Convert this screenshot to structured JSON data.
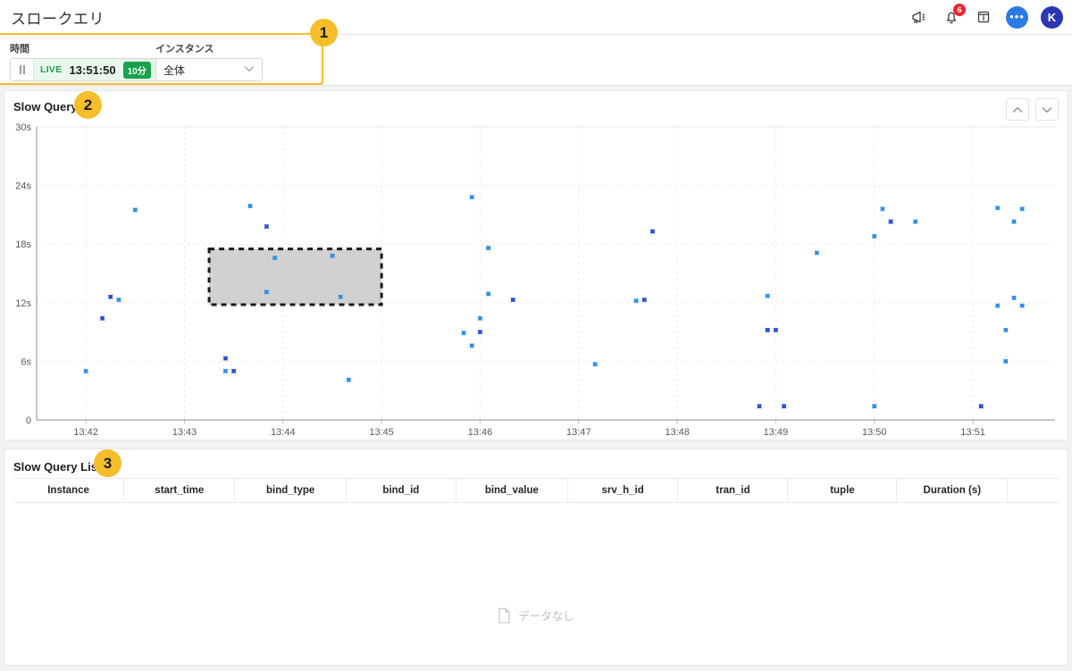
{
  "header": {
    "title": "スロークエリ",
    "icons": [
      {
        "name": "megaphone-icon",
        "label": "announcements"
      },
      {
        "name": "bell-icon",
        "label": "notifications",
        "badge": "6"
      },
      {
        "name": "info-box-icon",
        "label": "info"
      },
      {
        "name": "chat-icon",
        "label": "chat",
        "glyph": "•••"
      },
      {
        "name": "avatar",
        "label": "K"
      }
    ]
  },
  "filters": {
    "time": {
      "label": "時間",
      "pause_aria": "pause",
      "live_label": "LIVE",
      "time_value": "13:51:50",
      "range_badge": "10分"
    },
    "instance": {
      "label": "インスタンス",
      "value": "全体",
      "options": [
        "全体"
      ]
    }
  },
  "badges": {
    "one": "1",
    "two": "2",
    "three": "3"
  },
  "chart_panel": {
    "title": "Slow Query",
    "scroll_up_label": "∧",
    "scroll_down_label": "∨"
  },
  "table_panel": {
    "title": "Slow Query List",
    "columns": [
      "Instance",
      "start_time",
      "bind_type",
      "bind_id",
      "bind_value",
      "srv_h_id",
      "tran_id",
      "tuple",
      "Duration (s)",
      ""
    ],
    "empty_text": "データなし"
  },
  "colors": {
    "accent_badge": "#f5be2a",
    "live_green": "#16a34a",
    "marker_dark": "#2b4fd0",
    "marker_light": "#2e90e8",
    "selection_fill": "#c9c9c9",
    "notification_red": "#f5222d"
  },
  "chart_data": {
    "type": "scatter",
    "title": "Slow Query",
    "xlabel": "",
    "ylabel": "",
    "grid": true,
    "legend": null,
    "x_ticks": [
      "13:42",
      "13:43",
      "13:44",
      "13:45",
      "13:46",
      "13:47",
      "13:48",
      "13:49",
      "13:50",
      "13:51"
    ],
    "y_ticks": [
      "0",
      "6s",
      "12s",
      "18s",
      "24s",
      "30s"
    ],
    "xlim": [
      "13:41:30",
      "13:51:50"
    ],
    "ylim": [
      0,
      30
    ],
    "y_unit": "s",
    "selection_box": {
      "x0": "13:43:15",
      "x1": "13:45:00",
      "y0": 11.8,
      "y1": 17.5
    },
    "series": [
      {
        "name": "light",
        "color": "#2e90e8",
        "points": [
          {
            "t": "13:42:30",
            "v": 21.5
          },
          {
            "t": "13:42:00",
            "v": 5.0
          },
          {
            "t": "13:42:20",
            "v": 12.3
          },
          {
            "t": "13:43:40",
            "v": 21.9
          },
          {
            "t": "13:43:55",
            "v": 16.6
          },
          {
            "t": "13:43:50",
            "v": 13.1
          },
          {
            "t": "13:44:30",
            "v": 16.8
          },
          {
            "t": "13:44:35",
            "v": 12.6
          },
          {
            "t": "13:44:40",
            "v": 4.1
          },
          {
            "t": "13:43:25",
            "v": 5.0
          },
          {
            "t": "13:45:55",
            "v": 22.8
          },
          {
            "t": "13:46:05",
            "v": 12.9
          },
          {
            "t": "13:46:05",
            "v": 17.6
          },
          {
            "t": "13:46:00",
            "v": 10.4
          },
          {
            "t": "13:45:55",
            "v": 7.6
          },
          {
            "t": "13:45:50",
            "v": 8.9
          },
          {
            "t": "13:47:35",
            "v": 12.2
          },
          {
            "t": "13:47:10",
            "v": 5.7
          },
          {
            "t": "13:49:25",
            "v": 17.1
          },
          {
            "t": "13:48:55",
            "v": 12.7
          },
          {
            "t": "13:48:55",
            "v": 9.2
          },
          {
            "t": "13:50:05",
            "v": 21.6
          },
          {
            "t": "13:50:10",
            "v": 20.3
          },
          {
            "t": "13:50:25",
            "v": 20.3
          },
          {
            "t": "13:50:00",
            "v": 18.8
          },
          {
            "t": "13:51:15",
            "v": 21.7
          },
          {
            "t": "13:51:30",
            "v": 21.6
          },
          {
            "t": "13:51:25",
            "v": 20.3
          },
          {
            "t": "13:51:25",
            "v": 12.5
          },
          {
            "t": "13:51:15",
            "v": 11.7
          },
          {
            "t": "13:51:30",
            "v": 11.7
          },
          {
            "t": "13:51:20",
            "v": 9.2
          },
          {
            "t": "13:51:20",
            "v": 6.0
          },
          {
            "t": "13:50:00",
            "v": 1.4
          }
        ]
      },
      {
        "name": "dark",
        "color": "#2b4fd0",
        "points": [
          {
            "t": "13:42:15",
            "v": 12.6
          },
          {
            "t": "13:42:10",
            "v": 10.4
          },
          {
            "t": "13:43:50",
            "v": 19.8
          },
          {
            "t": "13:43:25",
            "v": 6.3
          },
          {
            "t": "13:43:30",
            "v": 5.0
          },
          {
            "t": "13:46:20",
            "v": 12.3
          },
          {
            "t": "13:46:00",
            "v": 9.0
          },
          {
            "t": "13:47:45",
            "v": 19.3
          },
          {
            "t": "13:47:40",
            "v": 12.3
          },
          {
            "t": "13:48:55",
            "v": 9.2
          },
          {
            "t": "13:49:00",
            "v": 9.2
          },
          {
            "t": "13:50:10",
            "v": 20.3
          },
          {
            "t": "13:49:05",
            "v": 1.4
          },
          {
            "t": "13:48:50",
            "v": 1.4
          },
          {
            "t": "13:51:05",
            "v": 1.4
          }
        ]
      }
    ]
  }
}
